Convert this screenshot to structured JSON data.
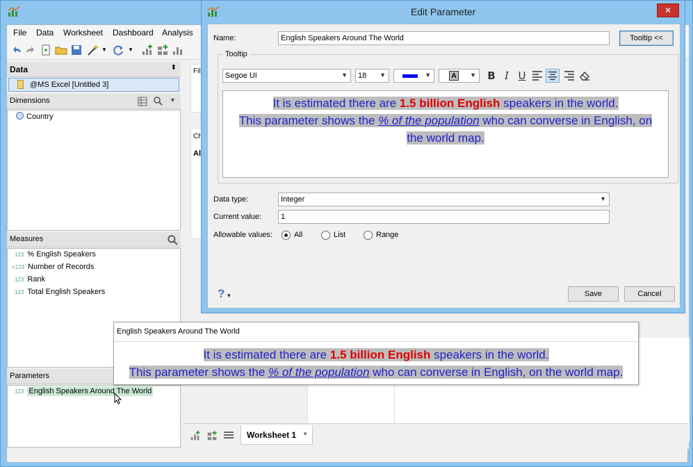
{
  "main": {
    "menu": [
      "File",
      "Data",
      "Worksheet",
      "Dashboard",
      "Analysis"
    ],
    "data_pane": {
      "header": "Data",
      "source": "@MS Excel [Untitled 3]"
    },
    "dimensions": {
      "header": "Dimensions",
      "items": [
        {
          "label": "Country",
          "icon": "globe-icon"
        }
      ]
    },
    "measures": {
      "header": "Measures",
      "items": [
        {
          "tag": "123",
          "label": "% English Speakers"
        },
        {
          "tag": "=123",
          "label": "Number of Records"
        },
        {
          "tag": "123",
          "label": "Rank"
        },
        {
          "tag": "123",
          "label": "Total English Speakers"
        }
      ]
    },
    "parameters": {
      "header": "Parameters",
      "items": [
        {
          "tag": "123",
          "label": "English Speakers Around The World"
        }
      ]
    },
    "sheet_fragments": {
      "filters_partial": "Fil",
      "charts_partial": "Ch",
      "all_partial": "Al"
    },
    "bottom": {
      "worksheet_tab": "Worksheet 1"
    }
  },
  "tooltip_popup": {
    "header": "English Speakers Around The World",
    "line1_pre": "It is estimated there are ",
    "line1_bold": "1.5 billion English",
    "line1_post": " speakers in the world.",
    "line2_pre": "This parameter shows the ",
    "line2_link": "% of the population",
    "line2_post": " who can converse in English, on the world map."
  },
  "dialog": {
    "title": "Edit Parameter",
    "close_label": "✕",
    "name_label": "Name:",
    "name_value": "English Speakers Around The World",
    "tooltip_toggle": "Tooltip <<",
    "tooltip_group": "Tooltip",
    "font_family": "Segoe UI",
    "font_size": "18",
    "text_color": "#0000ff",
    "highlight_glyph": "A",
    "editor": {
      "line1_pre": "It is estimated there are ",
      "line1_bold": "1.5 billion English",
      "line1_post": " speakers in the world.",
      "line2_pre": "This parameter shows the ",
      "line2_link": "% of the population",
      "line2_post": " who can converse in English, on",
      "line3": "the world map."
    },
    "data_type_label": "Data type:",
    "data_type_value": "Integer",
    "current_value_label": "Current value:",
    "current_value": "1",
    "allowable_label": "Allowable values:",
    "allowable_options": [
      "All",
      "List",
      "Range"
    ],
    "allowable_selected": "All",
    "help_label": "?",
    "save_label": "Save",
    "cancel_label": "Cancel"
  }
}
